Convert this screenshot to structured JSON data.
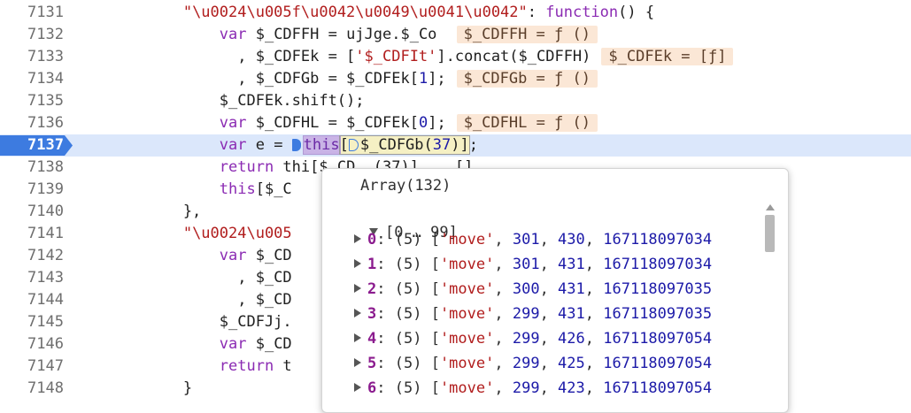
{
  "editor": {
    "lines": [
      {
        "no": "7131",
        "parts": [
          [
            "plain",
            "            "
          ],
          [
            "str",
            "\"\\u0024\\u005f\\u0042\\u0049\\u0041\\u0042\""
          ],
          [
            "plain",
            ": "
          ],
          [
            "kw",
            "function"
          ],
          [
            "plain",
            "() {"
          ]
        ]
      },
      {
        "no": "7132",
        "parts": [
          [
            "plain",
            "                "
          ],
          [
            "kw",
            "var"
          ],
          [
            "plain",
            " $_CDFFH = ujJge.$_Co "
          ]
        ],
        "inline": "$_CDFFH = ƒ ()"
      },
      {
        "no": "7133",
        "parts": [
          [
            "plain",
            "                  , $_CDFEk = ["
          ],
          [
            "str",
            "'$_CDFIt'"
          ],
          [
            "plain",
            "].concat($_CDFFH)"
          ]
        ],
        "inline": "$_CDFEk = [ƒ]"
      },
      {
        "no": "7134",
        "parts": [
          [
            "plain",
            "                  , $_CDFGb = $_CDFEk["
          ],
          [
            "num",
            "1"
          ],
          [
            "plain",
            "];"
          ]
        ],
        "inline": "$_CDFGb = ƒ ()"
      },
      {
        "no": "7135",
        "parts": [
          [
            "plain",
            "                $_CDFEk.shift();"
          ]
        ]
      },
      {
        "no": "7136",
        "parts": [
          [
            "plain",
            "                "
          ],
          [
            "kw",
            "var"
          ],
          [
            "plain",
            " $_CDFHL = $_CDFEk["
          ],
          [
            "num",
            "0"
          ],
          [
            "plain",
            "];"
          ]
        ],
        "inline": "$_CDFHL = ƒ ()"
      },
      {
        "no": "7137",
        "current": true,
        "parts": []
      },
      {
        "no": "7138",
        "parts": [
          [
            "plain",
            "                "
          ],
          [
            "kw",
            "return"
          ],
          [
            "plain",
            " thi"
          ]
        ]
      },
      {
        "no": "7139",
        "parts": [
          [
            "plain",
            "                "
          ],
          [
            "kw",
            "this"
          ],
          [
            "plain",
            "[$_C"
          ]
        ]
      },
      {
        "no": "7140",
        "parts": [
          [
            "plain",
            "            },"
          ]
        ]
      },
      {
        "no": "7141",
        "parts": [
          [
            "plain",
            "            "
          ],
          [
            "str",
            "\"\\u0024\\u005"
          ]
        ]
      },
      {
        "no": "7142",
        "parts": [
          [
            "plain",
            "                "
          ],
          [
            "kw",
            "var"
          ],
          [
            "plain",
            " $_CD"
          ]
        ]
      },
      {
        "no": "7143",
        "parts": [
          [
            "plain",
            "                  , $_CD"
          ]
        ]
      },
      {
        "no": "7144",
        "parts": [
          [
            "plain",
            "                  , $_CD"
          ]
        ]
      },
      {
        "no": "7145",
        "parts": [
          [
            "plain",
            "                $_CDFJj."
          ]
        ]
      },
      {
        "no": "7146",
        "parts": [
          [
            "plain",
            "                "
          ],
          [
            "kw",
            "var"
          ],
          [
            "plain",
            " $_CD"
          ]
        ]
      },
      {
        "no": "7147",
        "parts": [
          [
            "plain",
            "                "
          ],
          [
            "kw",
            "return"
          ],
          [
            "plain",
            " t"
          ]
        ]
      },
      {
        "no": "7148",
        "parts": [
          [
            "plain",
            "            }"
          ]
        ]
      }
    ],
    "current_line": {
      "lead": "                ",
      "kw": "var",
      "rest": " e = ",
      "this": "this",
      "bracket_open": "[",
      "call_name": "$_CDFGb(",
      "call_arg": "37",
      "call_close": ")",
      "bracket_close": "]",
      "semi": ";"
    },
    "line_7138_tail": "[$_CD  (37)]    []"
  },
  "popover": {
    "title": "Array(132)",
    "group_label": "[0 … 99]",
    "rows": [
      {
        "index": "0",
        "len": "(5)",
        "action": "'move'",
        "x": "301",
        "y": "430",
        "ts": "167118097034"
      },
      {
        "index": "1",
        "len": "(5)",
        "action": "'move'",
        "x": "301",
        "y": "431",
        "ts": "167118097034"
      },
      {
        "index": "2",
        "len": "(5)",
        "action": "'move'",
        "x": "300",
        "y": "431",
        "ts": "167118097035"
      },
      {
        "index": "3",
        "len": "(5)",
        "action": "'move'",
        "x": "299",
        "y": "431",
        "ts": "167118097035"
      },
      {
        "index": "4",
        "len": "(5)",
        "action": "'move'",
        "x": "299",
        "y": "426",
        "ts": "167118097054"
      },
      {
        "index": "5",
        "len": "(5)",
        "action": "'move'",
        "x": "299",
        "y": "425",
        "ts": "167118097054"
      },
      {
        "index": "6",
        "len": "(5)",
        "action": "'move'",
        "x": "299",
        "y": "423",
        "ts": "167118097054"
      }
    ]
  },
  "colors": {
    "keyword": "#8b2bb3",
    "string": "#b11d1d",
    "number": "#1c1aa8",
    "breakpoint": "#3d7be0",
    "current_line_bg": "#dbe7fb",
    "inline_value_bg": "#fbe7d6"
  }
}
